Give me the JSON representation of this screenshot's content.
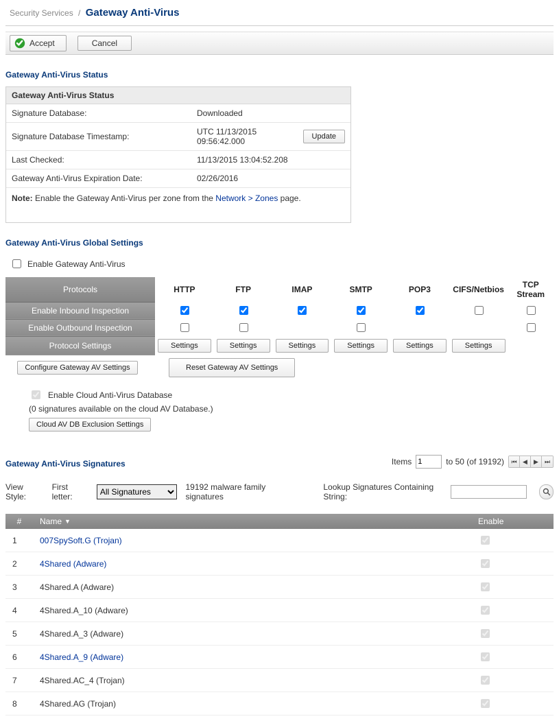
{
  "breadcrumb": {
    "parent": "Security Services",
    "current": "Gateway Anti-Virus"
  },
  "toolbar": {
    "accept": "Accept",
    "cancel": "Cancel"
  },
  "status": {
    "section_title": "Gateway Anti-Virus Status",
    "box_header": "Gateway Anti-Virus Status",
    "rows": {
      "sig_db_label": "Signature Database:",
      "sig_db_value": "Downloaded",
      "ts_label": "Signature Database Timestamp:",
      "ts_value": "UTC 11/13/2015 09:56:42.000",
      "update_btn": "Update",
      "last_checked_label": "Last Checked:",
      "last_checked_value": "11/13/2015 13:04:52.208",
      "exp_label": "Gateway Anti-Virus Expiration Date:",
      "exp_value": "02/26/2016"
    },
    "note_prefix": "Note:",
    "note_text_a": "Enable the Gateway Anti-Virus per zone from the ",
    "note_link": "Network > Zones",
    "note_text_b": " page."
  },
  "global": {
    "section_title": "Gateway Anti-Virus Global Settings",
    "enable_label": "Enable Gateway Anti-Virus",
    "enable_checked": false,
    "headers": {
      "protocols": "Protocols",
      "inbound": "Enable Inbound Inspection",
      "outbound": "Enable Outbound Inspection",
      "settings": "Protocol Settings"
    },
    "cols": [
      "HTTP",
      "FTP",
      "IMAP",
      "SMTP",
      "POP3",
      "CIFS/Netbios",
      "TCP Stream"
    ],
    "inbound_checked": [
      true,
      true,
      true,
      true,
      true,
      false,
      false
    ],
    "outbound_present": [
      true,
      true,
      false,
      true,
      false,
      false,
      true
    ],
    "outbound_checked": [
      false,
      false,
      false,
      false,
      false,
      false,
      false
    ],
    "settings_present": [
      true,
      true,
      true,
      true,
      true,
      true,
      false
    ],
    "settings_btn": "Settings",
    "configure_btn": "Configure Gateway AV Settings",
    "reset_btn": "Reset Gateway AV Settings",
    "cloud": {
      "enable_label": "Enable Cloud Anti-Virus Database",
      "enable_checked": true,
      "counter_text": "(0 signatures available on the cloud AV Database.)",
      "exclusion_btn": "Cloud AV DB Exclusion Settings"
    }
  },
  "signatures": {
    "section_title": "Gateway Anti-Virus Signatures",
    "items_label": "Items",
    "page_from": "1",
    "page_to_text": "to 50 (of 19192)",
    "view_style_label": "View Style:",
    "first_letter_label": "First letter:",
    "select_value": "All Signatures",
    "count_text": "19192 malware family signatures",
    "lookup_label": "Lookup Signatures Containing String:",
    "columns": {
      "num": "#",
      "name": "Name",
      "enable": "Enable"
    },
    "rows": [
      {
        "n": "1",
        "name": "007SpySoft.G (Trojan)",
        "link": true,
        "enabled": true
      },
      {
        "n": "2",
        "name": "4Shared (Adware)",
        "link": true,
        "enabled": true
      },
      {
        "n": "3",
        "name": "4Shared.A (Adware)",
        "link": false,
        "enabled": true
      },
      {
        "n": "4",
        "name": "4Shared.A_10 (Adware)",
        "link": false,
        "enabled": true
      },
      {
        "n": "5",
        "name": "4Shared.A_3 (Adware)",
        "link": false,
        "enabled": true
      },
      {
        "n": "6",
        "name": "4Shared.A_9 (Adware)",
        "link": true,
        "enabled": true
      },
      {
        "n": "7",
        "name": "4Shared.AC_4 (Trojan)",
        "link": false,
        "enabled": true
      },
      {
        "n": "8",
        "name": "4Shared.AG (Trojan)",
        "link": false,
        "enabled": true
      }
    ]
  }
}
